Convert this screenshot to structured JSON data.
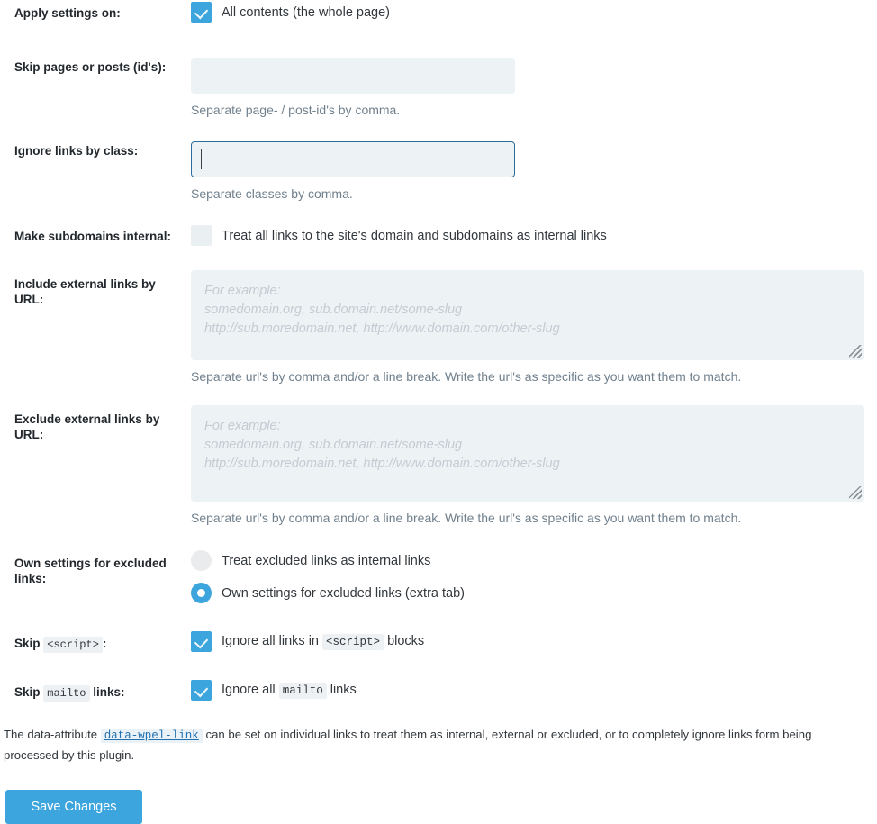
{
  "settings_form": {
    "rows": {
      "apply_settings": {
        "label": "Apply settings on:",
        "checkbox_label": "All contents (the whole page)",
        "checked": true
      },
      "skip_pages": {
        "label": "Skip pages or posts (id's):",
        "value": "",
        "placeholder": "",
        "help": "Separate page- / post-id's by comma."
      },
      "ignore_links_by_class": {
        "label": "Ignore links by class:",
        "value": "",
        "placeholder": "",
        "help": "Separate classes by comma.",
        "focused": true
      },
      "make_subdomains_internal": {
        "label": "Make subdomains internal:",
        "checkbox_label": "Treat all links to the site's domain and subdomains as internal links",
        "checked": false
      },
      "include_external": {
        "label": "Include external links by URL:",
        "value": "",
        "placeholder_lines": [
          "For example:",
          "somedomain.org, sub.domain.net/some-slug",
          "http://sub.moredomain.net, http://www.domain.com/other-slug"
        ],
        "help": "Separate url's by comma and/or a line break. Write the url's as specific as you want them to match."
      },
      "exclude_external": {
        "label": "Exclude external links by URL:",
        "value": "",
        "placeholder_lines": [
          "For example:",
          "somedomain.org, sub.domain.net/some-slug",
          "http://sub.moredomain.net, http://www.domain.com/other-slug"
        ],
        "help": "Separate url's by comma and/or a line break. Write the url's as specific as you want them to match."
      },
      "own_settings_excluded": {
        "label": "Own settings for excluded links:",
        "options": [
          {
            "label": "Treat excluded links as internal links",
            "selected": false
          },
          {
            "label": "Own settings for excluded links (extra tab)",
            "selected": true
          }
        ]
      },
      "skip_script": {
        "label_prefix": "Skip",
        "label_code": "<script>",
        "label_suffix": ":",
        "checkbox_prefix": "Ignore all links in",
        "checkbox_code": "<script>",
        "checkbox_suffix": "blocks",
        "checked": true
      },
      "skip_mailto": {
        "label_prefix": "Skip",
        "label_code": "mailto",
        "label_suffix": "links:",
        "checkbox_prefix": "Ignore all",
        "checkbox_code": "mailto",
        "checkbox_suffix": "links",
        "checked": true
      }
    },
    "footer_note": {
      "prefix": "The data-attribute",
      "link": "data-wpel-link",
      "suffix": "can be set on individual links to treat them as internal, external or excluded, or to completely ignore links form being processed by this plugin."
    },
    "save_button_label": "Save Changes",
    "colors": {
      "accent": "#3ca5dd",
      "field_background": "#edf2f4",
      "focus_border": "#2b6e9b",
      "link": "#2271b1",
      "help_text": "#70808d"
    }
  }
}
